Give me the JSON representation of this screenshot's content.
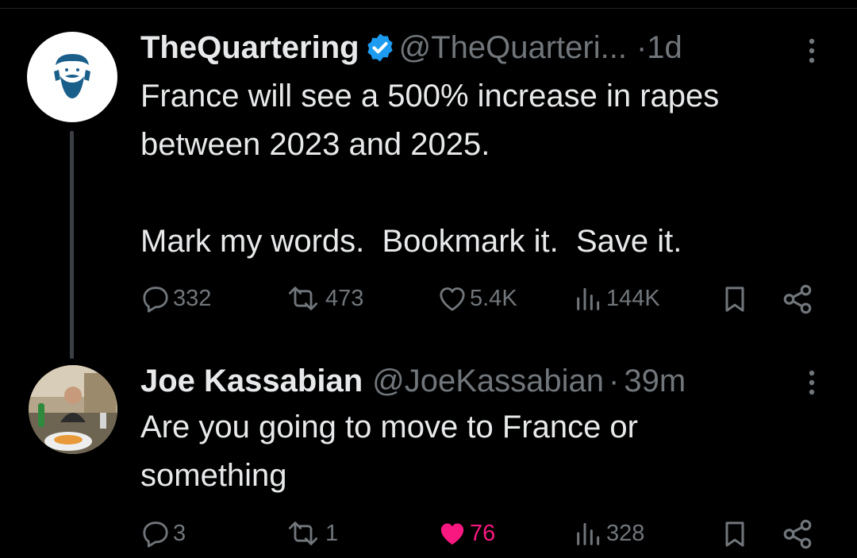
{
  "tweets": [
    {
      "name": "TheQuartering",
      "handle": "@TheQuarteri...",
      "time": "1d",
      "dot": "·",
      "text": "France will see a 500% increase in rapes between 2023 and 2025.\n\nMark my words.  Bookmark it.  Save it.",
      "replies": "332",
      "reposts": "473",
      "likes": "5.4K",
      "views": "144K",
      "verified": true
    },
    {
      "name": "Joe Kassabian",
      "handle": "@JoeKassabian",
      "time": "39m",
      "dot": "·",
      "text": "Are you going to move to France or\nsomething",
      "replies": "3",
      "reposts": "1",
      "likes": "76",
      "views": "328",
      "liked": true
    }
  ],
  "colors": {
    "verified": "#1d9bf0",
    "like_active": "#f91880",
    "muted": "#71767b",
    "text": "#e7e9ea",
    "avatar_icon": "#1a5f8a"
  }
}
